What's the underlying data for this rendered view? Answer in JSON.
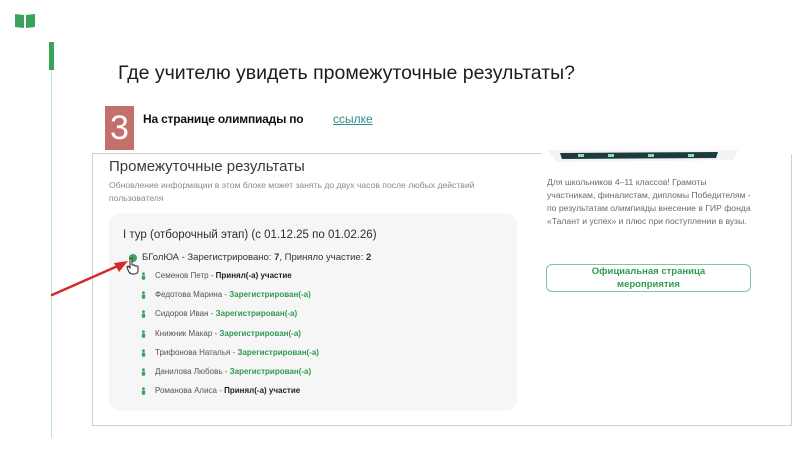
{
  "slide": {
    "title": "Где учителю увидеть промежуточные результаты?",
    "step_number": "3",
    "step_text": "На странице олимпиады по",
    "step_link": "ссылке"
  },
  "results": {
    "title": "Промежуточные результаты",
    "subtitle": "Обновление информации в этом блоке может занять до двух часов после любых действий пользователя",
    "tour_title": "I тур (отборочный этап) (с 01.12.25 по 01.02.26)",
    "school": {
      "name": "БГолЮА",
      "registered_label": " - Зарегистрировано: ",
      "registered_count": "7",
      "accepted_label": ", Приняло участие: ",
      "accepted_count": "2"
    },
    "participants": [
      {
        "name": "Семенов Петр",
        "status": "Принял(-а) участие",
        "status_color": "dark"
      },
      {
        "name": "Федотова Марина",
        "status": "Зарегистрирован(-а)",
        "status_color": "green"
      },
      {
        "name": "Сидоров Иван",
        "status": "Зарегистрирован(-а)",
        "status_color": "green"
      },
      {
        "name": "Книжник Макар",
        "status": "Зарегистрирован(-а)",
        "status_color": "green"
      },
      {
        "name": "Трифонова Наталья",
        "status": "Зарегистрирован(-а)",
        "status_color": "green"
      },
      {
        "name": "Данилова Любовь",
        "status": "Зарегистрирован(-а)",
        "status_color": "green"
      },
      {
        "name": "Романова Алиса",
        "status": "Принял(-а) участие",
        "status_color": "dark"
      }
    ]
  },
  "sidebar": {
    "info_text": "Для школьников 4–11 классов! Грамоты участникам, финалистам, дипломы Победителям - по результатам олимпиады внесение в ГИР фонда «Талант и успех» и плюс при поступлении в вузы.",
    "official_button_line1": "Официальная страница",
    "official_button_line2": "мероприятия"
  },
  "colors": {
    "accent_green": "#3aa35a",
    "badge": "#c4706a",
    "arrow": "#d42a2a",
    "link": "#2a8c8c"
  },
  "icons": [
    "book-icon",
    "cursor-icon",
    "person-icon",
    "arrow-pointer"
  ]
}
